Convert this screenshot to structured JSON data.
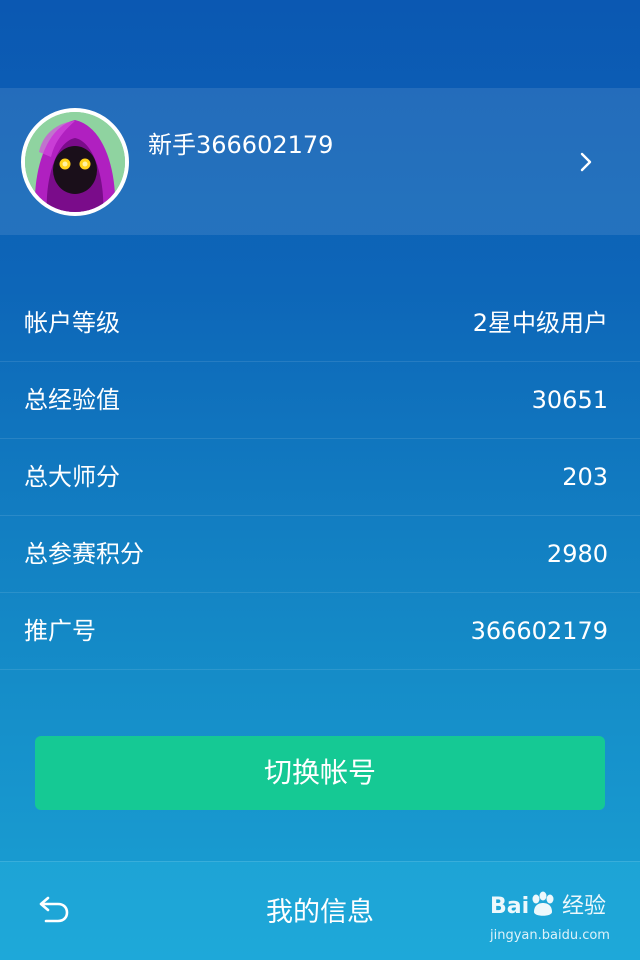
{
  "profile": {
    "name": "新手366602179"
  },
  "info_rows": [
    {
      "label": "帐户等级",
      "value": "2星中级用户"
    },
    {
      "label": "总经验值",
      "value": "30651"
    },
    {
      "label": "总大师分",
      "value": "203"
    },
    {
      "label": "总参赛积分",
      "value": "2980"
    },
    {
      "label": "推广号",
      "value": "366602179"
    }
  ],
  "switch_button": {
    "label": "切换帐号"
  },
  "bottom_bar": {
    "title": "我的信息"
  },
  "watermark": {
    "brand_left": "Bai",
    "brand_right": "经验",
    "url": "jingyan.baidu.com"
  },
  "colors": {
    "accent_button": "#15c994",
    "background_top": "#0b58b2",
    "background_bottom": "#1aa2d4",
    "text": "#ffffff"
  },
  "icons": {
    "back": "back-arrow-icon",
    "chevron": "chevron-right-icon"
  }
}
